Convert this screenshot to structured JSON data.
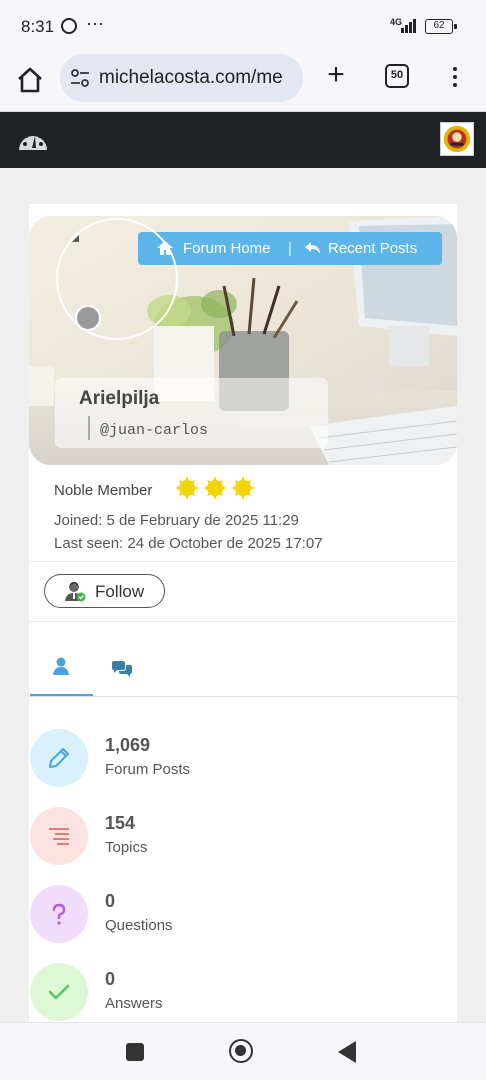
{
  "status_bar": {
    "time": "8:31",
    "dots": "⋯",
    "network": "4G",
    "battery": "62"
  },
  "browser": {
    "url": "michelacosta.com/me",
    "tab_count": "50"
  },
  "nav": {
    "home_label": "Forum Home",
    "separator": "|",
    "recent_label": "Recent Posts"
  },
  "profile": {
    "name": "Arielpilja",
    "handle": "@juan-carlos",
    "rank": "Noble Member",
    "rank_stars": 3,
    "joined": "Joined: 5 de February de 2025 11:29",
    "last_seen": "Last seen: 24 de October de 2025 17:07",
    "follow_label": "Follow"
  },
  "stats": [
    {
      "value": "1,069",
      "label": "Forum Posts",
      "icon": "pencil-icon",
      "color": "#d8f1fb"
    },
    {
      "value": "154",
      "label": "Topics",
      "icon": "lines-icon",
      "color": "#fde2e2"
    },
    {
      "value": "0",
      "label": "Questions",
      "icon": "question-icon",
      "color": "#f1dcfb"
    },
    {
      "value": "0",
      "label": "Answers",
      "icon": "check-icon",
      "color": "#dcf8d4"
    }
  ],
  "colors": {
    "accent": "#5bb5e8",
    "header_bg": "#1f2225",
    "star": "#f2d500"
  }
}
